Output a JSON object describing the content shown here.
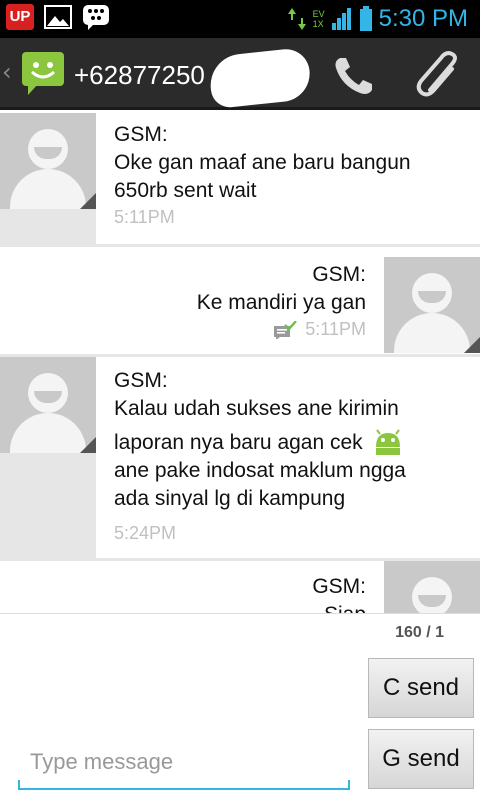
{
  "status_bar": {
    "up_badge": "UP",
    "network_top": "EV",
    "network_bottom": "1X",
    "time": "5:30 PM"
  },
  "header": {
    "contact_number": "+62877250",
    "back_glyph": "‹"
  },
  "messages": [
    {
      "direction": "incoming",
      "sender": "GSM:",
      "lines": [
        "Oke gan maaf ane baru bangun",
        "650rb sent wait"
      ],
      "time": "5:11PM"
    },
    {
      "direction": "outgoing",
      "sender": "GSM:",
      "lines": [
        "Ke mandiri ya gan"
      ],
      "time": "5:11PM",
      "delivered": true
    },
    {
      "direction": "incoming",
      "sender": "GSM:",
      "lines": [
        "Kalau udah sukses ane kirimin",
        "laporan nya baru agan cek",
        "ane pake indosat maklum ngga",
        "ada sinyal lg di kampung"
      ],
      "time": "5:24PM"
    },
    {
      "direction": "outgoing",
      "sender": "GSM:",
      "lines": [
        "Siap"
      ]
    }
  ],
  "composer": {
    "counter": "160 / 1",
    "c_send_label": "C send",
    "g_send_label": "G send",
    "placeholder": "Type message",
    "value": ""
  },
  "colors": {
    "accent": "#33b5e5",
    "header_bg": "#2b2b2b",
    "sms_icon": "#8cc63f"
  }
}
